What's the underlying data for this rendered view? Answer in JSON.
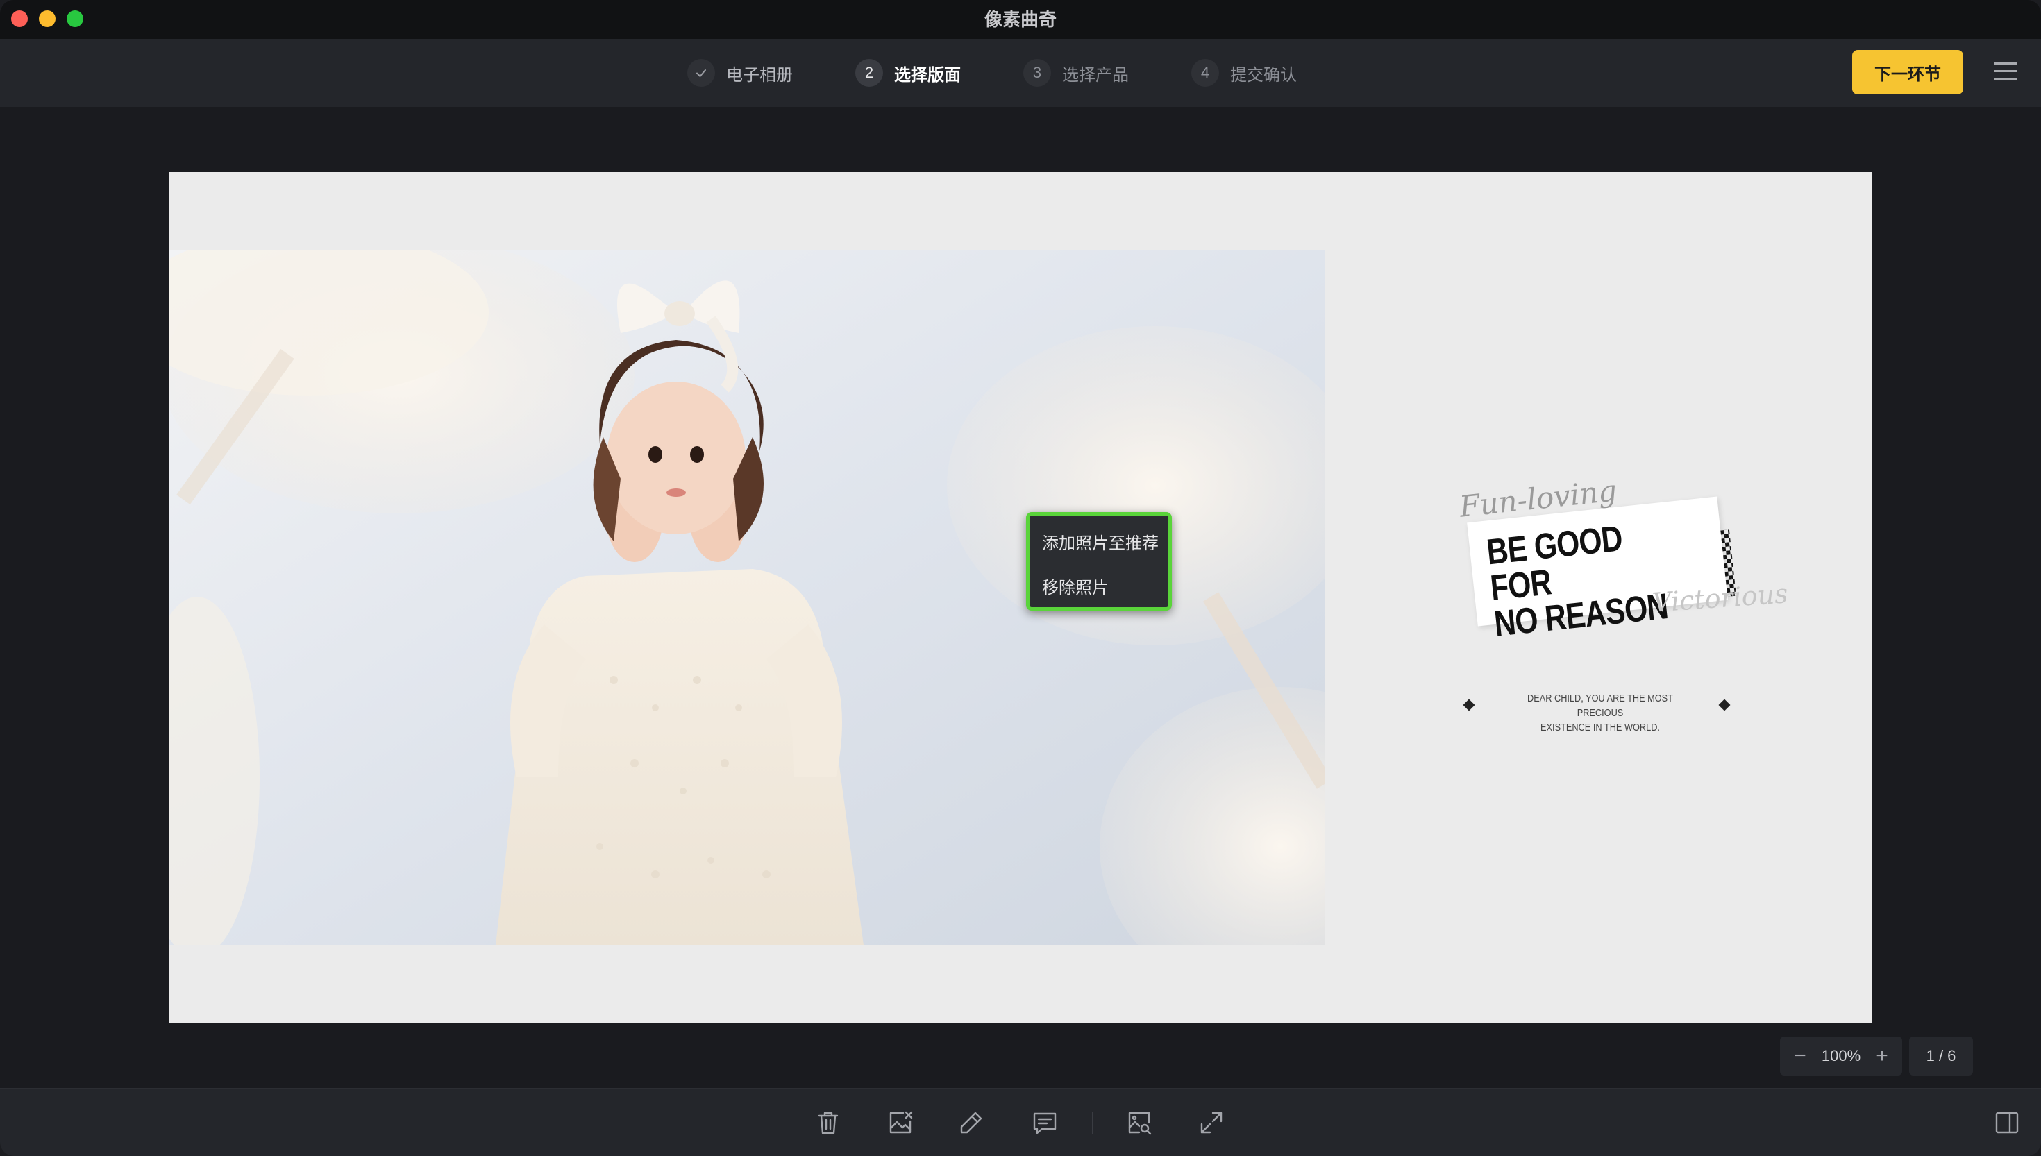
{
  "app": {
    "title": "像素曲奇"
  },
  "steps": [
    {
      "badge": "✓",
      "label": "电子相册",
      "state": "done"
    },
    {
      "badge": "2",
      "label": "选择版面",
      "state": "active"
    },
    {
      "badge": "3",
      "label": "选择产品",
      "state": "pending"
    },
    {
      "badge": "4",
      "label": "提交确认",
      "state": "pending"
    }
  ],
  "header": {
    "next_label": "下一环节",
    "menu_icon": "hamburger-menu-icon"
  },
  "context_menu": {
    "items": [
      "添加照片至推荐",
      "移除照片"
    ],
    "highlight_color": "#5ad43a"
  },
  "layout_page": {
    "script_top": "Fun-loving",
    "sticker_line1": "BE GOOD FOR",
    "sticker_line2": "NO REASON",
    "script_bottom": "Victorious",
    "caption_line1": "DEAR CHILD, YOU ARE THE MOST PRECIOUS",
    "caption_line2": "EXISTENCE IN THE WORLD."
  },
  "zoom": {
    "minus": "−",
    "value": "100%",
    "plus": "+"
  },
  "pager": {
    "value": "1 / 6"
  },
  "toolbar": {
    "tools": [
      "trash-icon",
      "replace-image-icon",
      "edit-pencil-icon",
      "text-comment-icon",
      "image-search-icon",
      "fullscreen-expand-icon"
    ],
    "panel_icon": "side-panel-icon"
  },
  "colors": {
    "accent": "#f6c431",
    "background": "#1a1b1f",
    "page": "#ebebeb"
  }
}
